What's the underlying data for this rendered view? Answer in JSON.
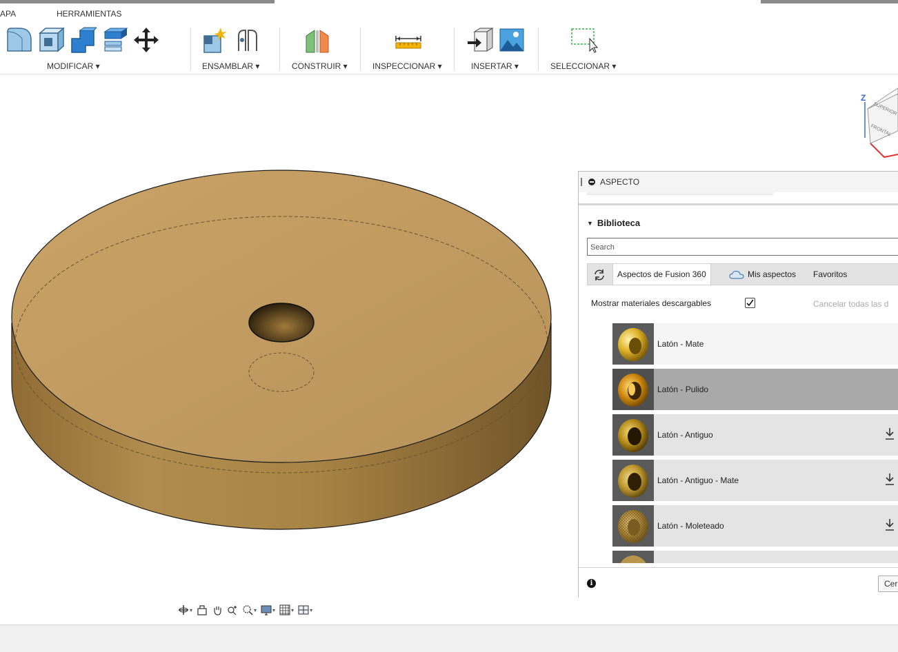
{
  "tabs": {
    "left": "APA",
    "herramientas": "HERRAMIENTAS"
  },
  "ribbon": {
    "modificar": "MODIFICAR ▾",
    "ensamblar": "ENSAMBLAR ▾",
    "construir": "CONSTRUIR ▾",
    "inspeccionar": "INSPECCIONAR ▾",
    "insertar": "INSERTAR ▾",
    "seleccionar": "SELECCIONAR ▾"
  },
  "viewcube": {
    "axis_z": "Z",
    "top": "SUPERIOR",
    "front": "FRONTAL"
  },
  "panel": {
    "title": "ASPECTO",
    "library_label": "Biblioteca",
    "search_placeholder": "Search",
    "tab_fusion": "Aspectos de Fusion 360",
    "tab_mine": "Mis aspectos",
    "tab_fav": "Favoritos",
    "show_downloadable": "Mostrar materiales descargables",
    "show_downloadable_checked": true,
    "cancel_all": "Cancelar todas las d",
    "materials": [
      {
        "name": "Latón - Mate",
        "selected": false,
        "download": false
      },
      {
        "name": "Latón - Pulido",
        "selected": true,
        "download": false
      },
      {
        "name": "Latón - Antiguo",
        "selected": false,
        "download": true
      },
      {
        "name": "Latón - Antiguo - Mate",
        "selected": false,
        "download": true
      },
      {
        "name": "Latón - Moleteado",
        "selected": false,
        "download": true
      }
    ],
    "close_btn": "Cerrar"
  },
  "colors": {
    "brass_top": "#c29a5e",
    "brass_side": "#a8813f",
    "selected_row": "#a9a9a9"
  }
}
